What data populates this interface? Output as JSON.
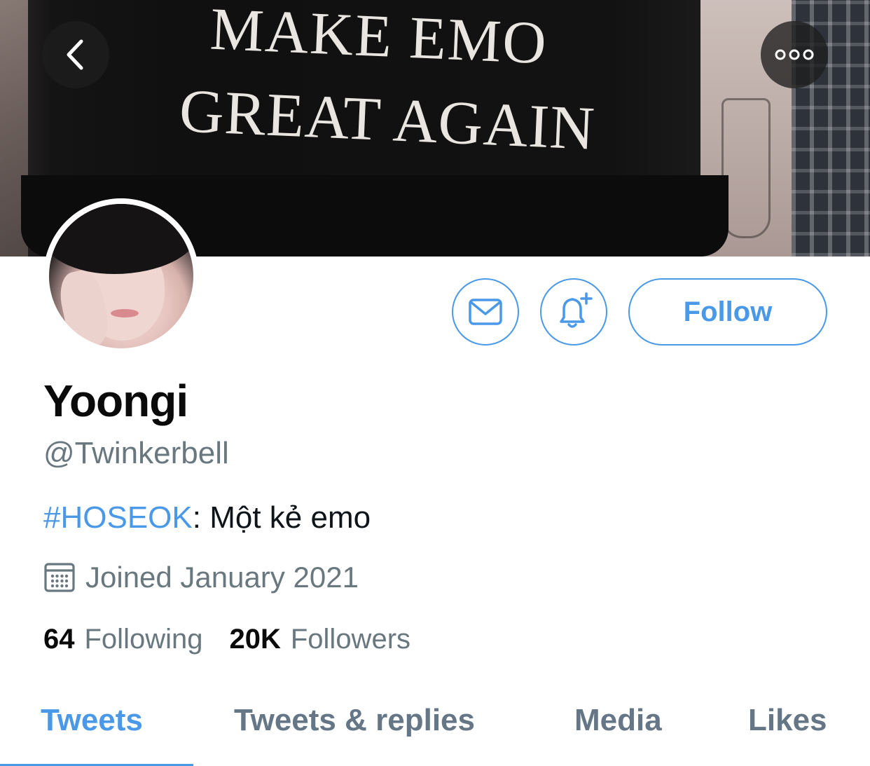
{
  "header": {
    "banner_text_line1": "MAKE  EMO",
    "banner_text_line2": "GREAT AGAIN",
    "back_icon": "chevron-left-icon",
    "more_icon": "more-horizontal-icon"
  },
  "actions": {
    "message_icon": "mail-icon",
    "notify_icon": "bell-plus-icon",
    "follow_label": "Follow",
    "accent_color": "#4a99e9"
  },
  "profile": {
    "display_name": "Yoongi",
    "handle": "@Twinkerbell",
    "bio_hashtag": "#HOSEOK",
    "bio_text": ": Một kẻ emo",
    "joined_icon": "calendar-icon",
    "joined_text": "Joined January 2021",
    "following_count": "64",
    "following_label": "Following",
    "followers_count": "20K",
    "followers_label": "Followers"
  },
  "tabs": [
    {
      "label": "Tweets",
      "active": true
    },
    {
      "label": "Tweets & replies",
      "active": false
    },
    {
      "label": "Media",
      "active": false
    },
    {
      "label": "Likes",
      "active": false
    }
  ]
}
